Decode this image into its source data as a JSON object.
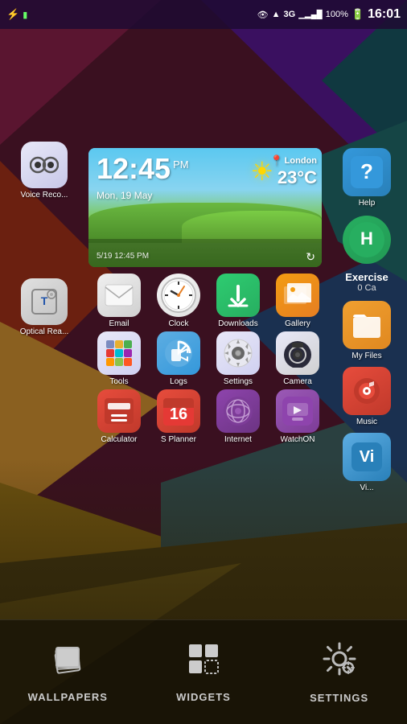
{
  "statusBar": {
    "time": "16:01",
    "battery": "100%",
    "network": "3G",
    "signal": "4 bars"
  },
  "weatherWidget": {
    "time": "12:45",
    "ampm": "PM",
    "date": "Mon, 19 May",
    "location": "London",
    "temp": "23°C",
    "bottom": "5/19  12:45 PM"
  },
  "rightColumn": {
    "items": [
      {
        "id": "help",
        "label": "Help",
        "icon": "?"
      },
      {
        "id": "exercise",
        "label": "Exercise",
        "value": "0 Ca"
      }
    ]
  },
  "leftColumn": {
    "items": [
      {
        "id": "voice-recorder",
        "label": "Voice Reco..."
      },
      {
        "id": "optical-reader",
        "label": "Optical Rea..."
      }
    ]
  },
  "appGrid": {
    "rows": [
      [
        {
          "id": "email",
          "label": "Email"
        },
        {
          "id": "clock",
          "label": "Clock"
        },
        {
          "id": "downloads",
          "label": "Downloads"
        },
        {
          "id": "gallery",
          "label": "Gallery"
        }
      ],
      [
        {
          "id": "tools",
          "label": "Tools"
        },
        {
          "id": "logs",
          "label": "Logs"
        },
        {
          "id": "settings",
          "label": "Settings"
        },
        {
          "id": "camera",
          "label": "Camera"
        }
      ],
      [
        {
          "id": "calculator",
          "label": "Calculator"
        },
        {
          "id": "splanner",
          "label": "S Planner"
        },
        {
          "id": "internet",
          "label": "Internet"
        },
        {
          "id": "watchon",
          "label": "WatchON"
        }
      ]
    ]
  },
  "rightApps": [
    {
      "id": "myfiles",
      "label": "My Files"
    },
    {
      "id": "music",
      "label": "Music"
    },
    {
      "id": "vi",
      "label": "Vi..."
    }
  ],
  "bottomBar": {
    "buttons": [
      {
        "id": "wallpapers",
        "label": "WALLPAPERS"
      },
      {
        "id": "widgets",
        "label": "WIDGETS"
      },
      {
        "id": "settings",
        "label": "SETTINGS"
      }
    ]
  }
}
